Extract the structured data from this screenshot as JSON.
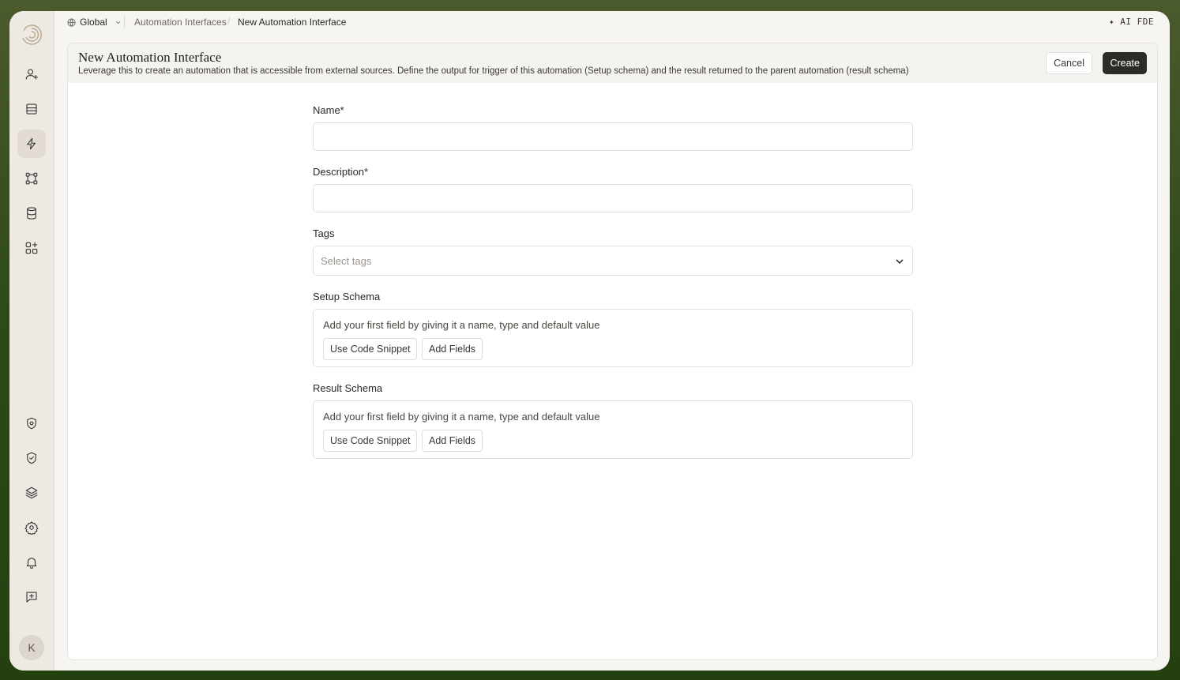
{
  "topbar": {
    "workspace": "Global",
    "breadcrumb": [
      "Automation Interfaces",
      "New Automation Interface"
    ],
    "breadcrumb_separator": "/",
    "ai_button": "✦ AI FDE"
  },
  "sidebar": {
    "top_items": [
      {
        "icon": "user-plus-icon"
      },
      {
        "icon": "inbox-icon"
      },
      {
        "icon": "lightning-icon",
        "active": true
      },
      {
        "icon": "workflow-icon"
      },
      {
        "icon": "database-icon"
      },
      {
        "icon": "apps-plus-icon"
      }
    ],
    "bottom_items": [
      {
        "icon": "shield-icon"
      },
      {
        "icon": "shield-check-icon"
      },
      {
        "icon": "layers-icon"
      },
      {
        "icon": "settings-icon"
      },
      {
        "icon": "bell-icon"
      },
      {
        "icon": "feedback-icon"
      }
    ],
    "avatar_initial": "K"
  },
  "header": {
    "title": "New Automation Interface",
    "description": "Leverage this to create an automation that is accessible from external sources. Define the output for trigger of this automation (Setup schema) and the result returned to the parent automation (result schema)",
    "cancel_label": "Cancel",
    "create_label": "Create"
  },
  "form": {
    "name_label": "Name*",
    "name_value": "",
    "description_label": "Description*",
    "description_value": "",
    "tags_label": "Tags",
    "tags_placeholder": "Select tags",
    "setup_schema": {
      "label": "Setup Schema",
      "hint": "Add your first field by giving it a name, type and default value",
      "code_snippet_label": "Use Code Snippet",
      "add_fields_label": "Add Fields"
    },
    "result_schema": {
      "label": "Result Schema",
      "hint": "Add your first field by giving it a name, type and default value",
      "code_snippet_label": "Use Code Snippet",
      "add_fields_label": "Add Fields"
    }
  },
  "colors": {
    "primary_button": "#2d2b28",
    "sidebar_bg": "#efe9e4",
    "header_bg": "#f5f3f0"
  }
}
